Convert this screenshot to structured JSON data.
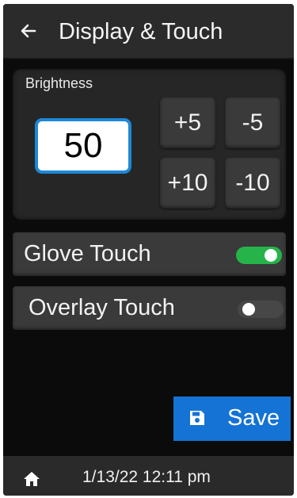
{
  "header": {
    "title": "Display & Touch",
    "back_icon": "arrow-left-icon"
  },
  "brightness": {
    "label": "Brightness",
    "value": "50",
    "buttons": {
      "plus5": "+5",
      "minus5": "-5",
      "plus10": "+10",
      "minus10": "-10"
    },
    "accent_color": "#1e88d6"
  },
  "toggles": [
    {
      "label": "Glove Touch",
      "state": "on",
      "color": "#26b34a"
    },
    {
      "label": "Overlay Touch",
      "state": "off",
      "color": "#474747"
    }
  ],
  "actions": {
    "save_label": "Save",
    "save_icon": "floppy-disk-icon",
    "save_color": "#1473d4"
  },
  "footer": {
    "home_icon": "home-icon",
    "datetime": "1/13/22 12:11 pm"
  }
}
